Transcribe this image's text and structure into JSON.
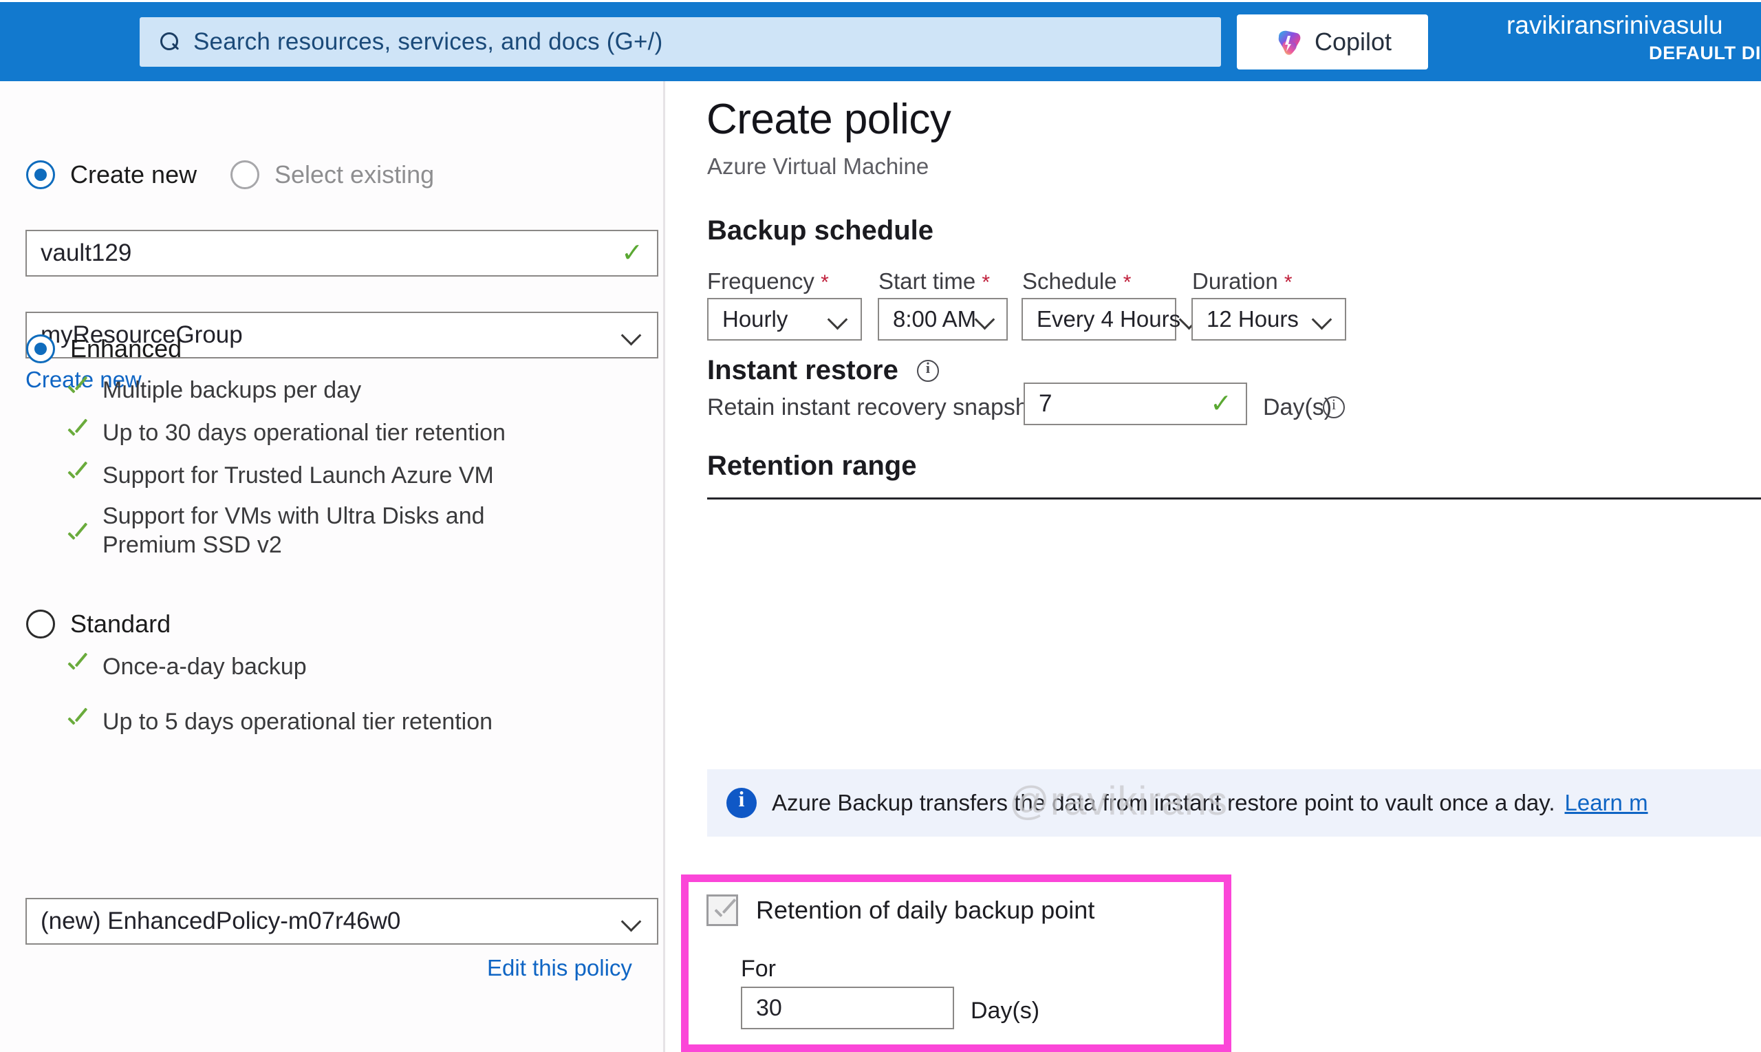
{
  "topbar": {
    "search_placeholder": "Search resources, services, and docs (G+/)",
    "copilot_label": "Copilot",
    "account_name": "ravikiransrinivasulu",
    "account_directory": "DEFAULT DI",
    "bar_color": "#1279ce"
  },
  "left_panel": {
    "vault_mode": {
      "create_new": "Create new",
      "select_existing": "Select existing",
      "selected": "Create new"
    },
    "vault_name": "vault129",
    "resource_group": "myResourceGroup",
    "create_new_link": "Create new",
    "tiers": [
      {
        "name": "Enhanced",
        "selected": true,
        "features": [
          "Multiple backups per day",
          "Up to 30 days operational tier retention",
          "Support for Trusted Launch Azure VM",
          "Support for VMs with Ultra Disks and Premium SSD v2"
        ]
      },
      {
        "name": "Standard",
        "selected": false,
        "features": [
          "Once-a-day backup",
          "Up to 5 days operational tier retention"
        ]
      }
    ],
    "policy_select": "(new) EnhancedPolicy-m07r46w0",
    "edit_policy_link": "Edit this policy"
  },
  "main": {
    "title": "Create policy",
    "subtitle": "Azure Virtual Machine",
    "backup_schedule": {
      "heading": "Backup schedule",
      "fields": [
        {
          "label": "Frequency",
          "required": "*",
          "value": "Hourly"
        },
        {
          "label": "Start time",
          "required": "*",
          "value": "8:00 AM"
        },
        {
          "label": "Schedule",
          "required": "*",
          "value": "Every 4 Hours"
        },
        {
          "label": "Duration",
          "required": "*",
          "value": "12 Hours"
        }
      ]
    },
    "instant_restore": {
      "heading": "Instant restore",
      "retain_label": "Retain instant recovery snapshot(s) for",
      "retain_value": "7",
      "unit": "Day(s)"
    },
    "retention_range": {
      "heading": "Retention range",
      "banner": "Azure Backup transfers the data from instant restore point to vault once a day.",
      "banner_link": "Learn m",
      "daily": {
        "checkbox_label": "Retention of daily backup point",
        "checked": true,
        "for_label": "For",
        "value": "30",
        "unit": "Day(s)",
        "highlight_color": "#fb46d8"
      }
    },
    "watermark": "@ravikirans"
  }
}
